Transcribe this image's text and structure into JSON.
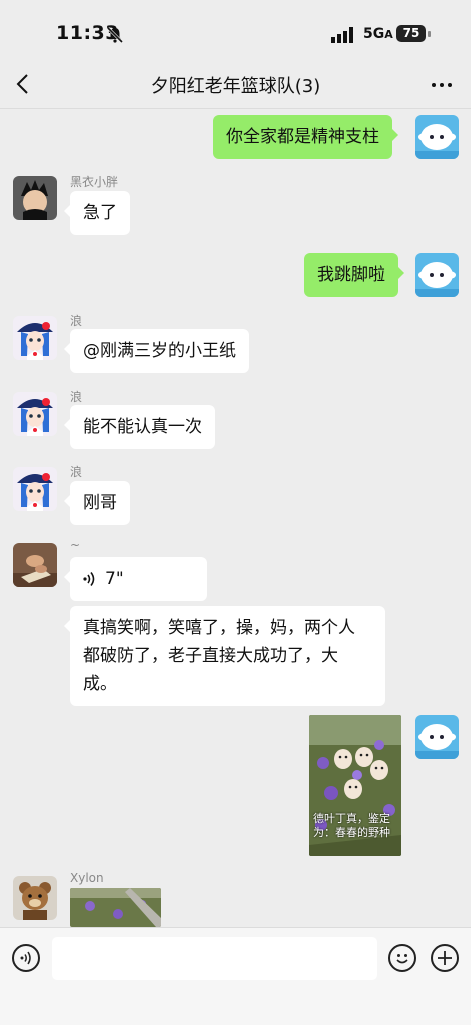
{
  "status_bar": {
    "time": "11:33",
    "network": "5G",
    "network_suffix": "A",
    "battery": "75"
  },
  "header": {
    "title": "夕阳红老年篮球队(3)"
  },
  "messages": [
    {
      "text": "你全家都是精神支柱"
    },
    {
      "sender": "黑衣小胖",
      "text": "急了"
    },
    {
      "text": "我跳脚啦"
    },
    {
      "sender": "浪",
      "text": "@刚满三岁的小王纸"
    },
    {
      "sender": "浪",
      "text": "能不能认真一次"
    },
    {
      "sender": "浪",
      "text": "刚哥"
    },
    {
      "sender": "~",
      "voice_duration": "7\""
    },
    {
      "text_lines": [
        "真搞笑啊，笑嘻了，操，妈，两个人",
        "都破防了，老子直接大成功了，大",
        "成。"
      ]
    },
    {
      "caption_lines": [
        "德叶丁真，鉴定",
        "为：春春的野种"
      ]
    },
    {
      "sender": "Xylon"
    }
  ],
  "colors": {
    "sent_bubble": "#95ec69",
    "received_bubble": "#ffffff",
    "background": "#ededed"
  },
  "icons": {
    "back": "chevron-left-icon",
    "more": "more-icon",
    "voice": "voice-icon",
    "emoji": "emoji-icon",
    "plus": "plus-icon"
  }
}
